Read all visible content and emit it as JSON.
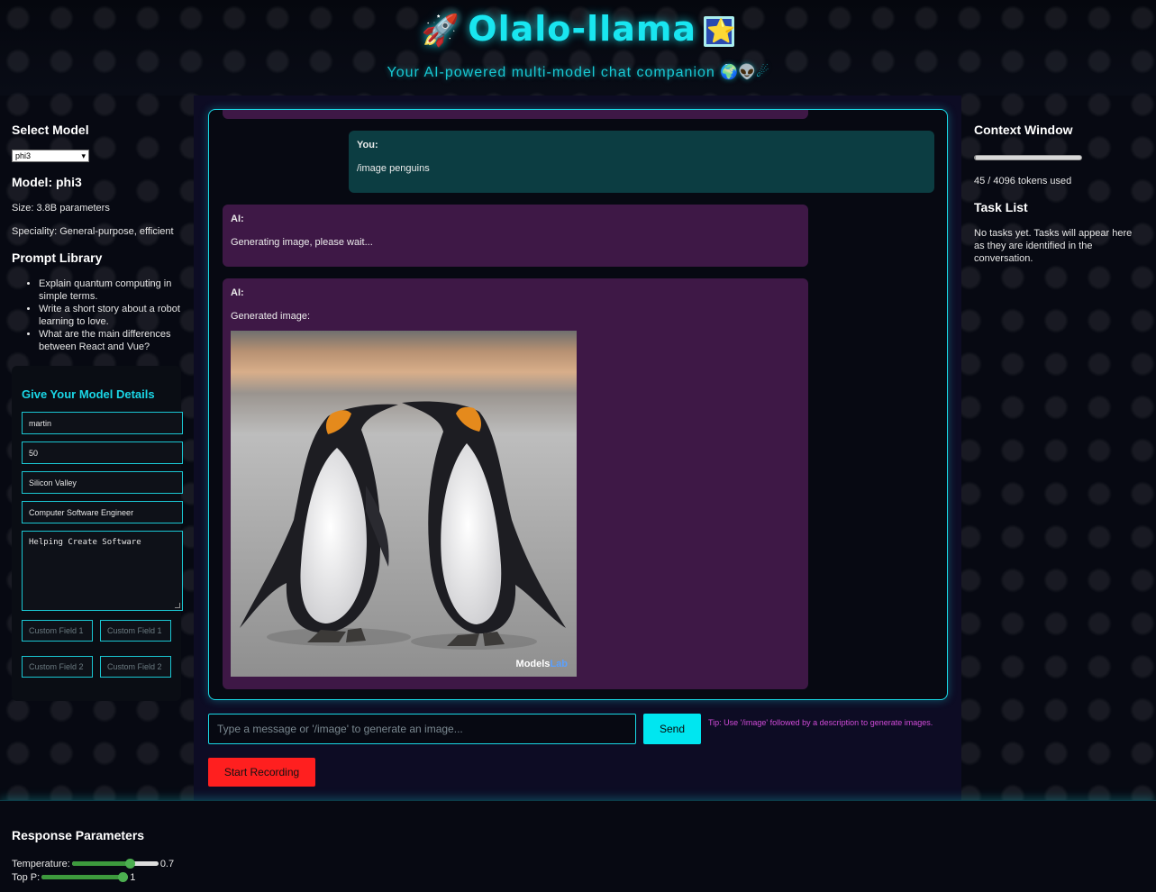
{
  "header": {
    "title": "Olalo-llama",
    "title_icon_left": "🚀",
    "title_icon_right": "⭐",
    "subtitle": "Your AI-powered multi-model chat companion",
    "subtitle_emojis": "🌍👽☄"
  },
  "left": {
    "select_model_heading": "Select Model",
    "selected_model": "phi3",
    "model_title": "Model: phi3",
    "size": "Size: 3.8B parameters",
    "speciality": "Speciality: General-purpose, efficient",
    "prompt_library_heading": "Prompt Library",
    "prompts": [
      "Explain quantum computing in simple terms.",
      "Write a short story about a robot learning to love.",
      "What are the main differences between React and Vue?"
    ],
    "details": {
      "heading": "Give Your Model Details",
      "name": "martin",
      "age": "50",
      "location": "Silicon Valley",
      "occupation": "Computer Software Engineer",
      "bio": "Helping Create Software",
      "custom_field_1a": "Custom Field 1",
      "custom_field_1b": "Custom Field 1",
      "custom_field_2a": "Custom Field 2",
      "custom_field_2b": "Custom Field 2"
    }
  },
  "chat": {
    "messages": [
      {
        "who": "You:",
        "text": "/image penguins"
      },
      {
        "who": "AI:",
        "text": "Generating image, please wait..."
      },
      {
        "who": "AI:",
        "text": "Generated image:"
      }
    ],
    "image_watermark_a": "Models",
    "image_watermark_b": "Lab",
    "input_placeholder": "Type a message or '/image' to generate an image...",
    "send_label": "Send",
    "tip": "Tip: Use '/image' followed by a description to generate images.",
    "record_label": "Start Recording"
  },
  "right": {
    "context_heading": "Context Window",
    "tokens_text": "45 / 4096 tokens used",
    "tokens_used": 45,
    "tokens_total": 4096,
    "task_heading": "Task List",
    "task_empty": "No tasks yet. Tasks will appear here as they are identified in the conversation."
  },
  "params": {
    "heading": "Response Parameters",
    "temperature_label": "Temperature:",
    "temperature": "0.7",
    "top_p_label": "Top P:",
    "top_p": "1"
  },
  "colors": {
    "accent": "#19e6f0",
    "ai_bubble": "#3e1846",
    "user_bubble": "#0c3d42",
    "record": "#ff1f1f",
    "tip": "#d04bd8"
  }
}
